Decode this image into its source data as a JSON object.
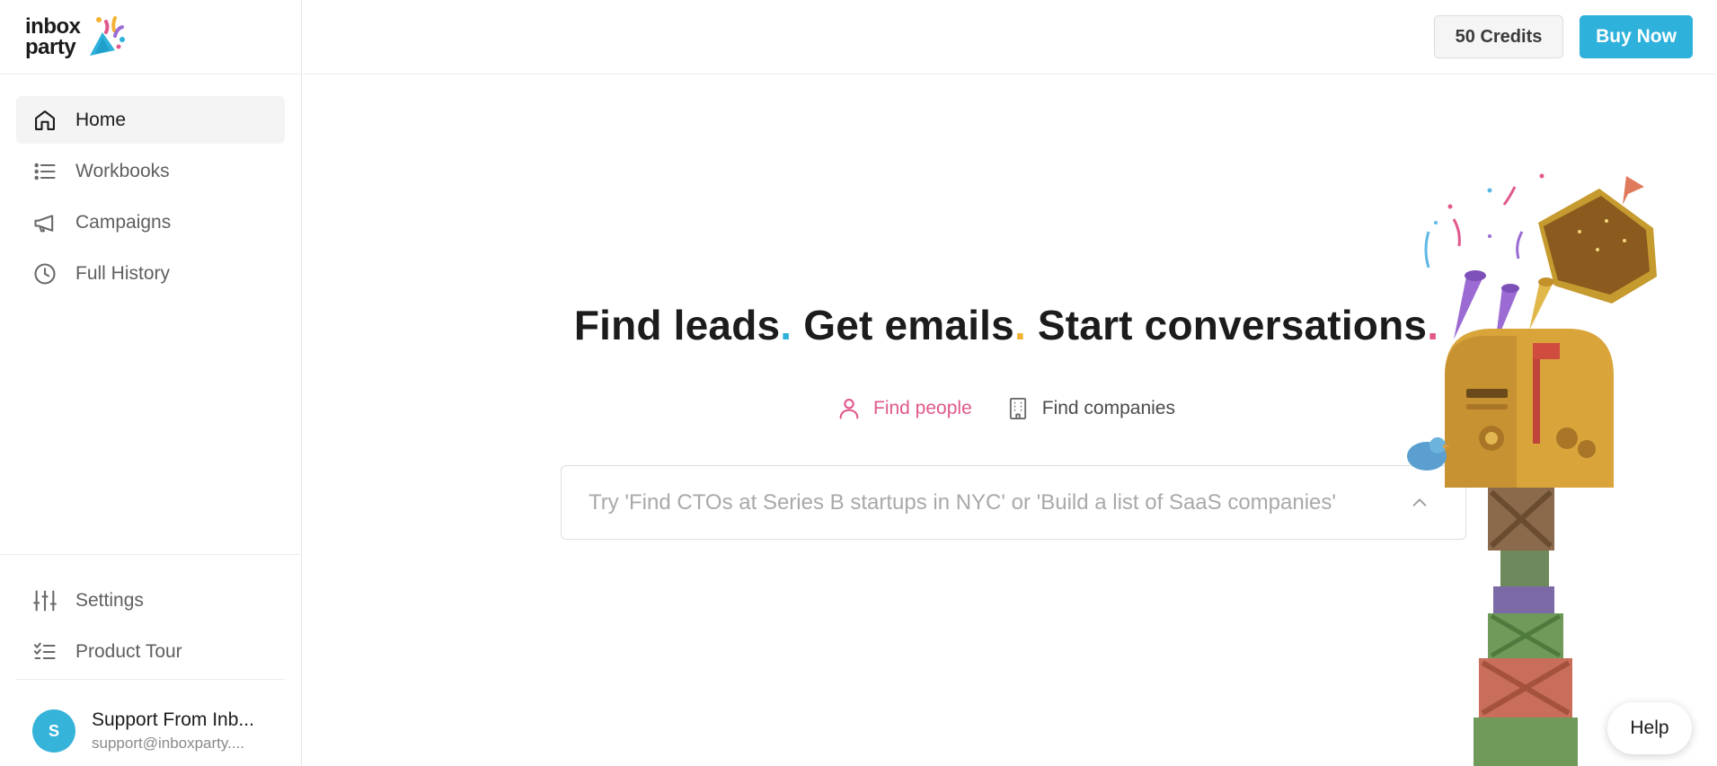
{
  "brand": {
    "line1": "inbox",
    "line2": "party"
  },
  "sidebar": {
    "items": [
      {
        "label": "Home",
        "icon": "home-icon",
        "active": true
      },
      {
        "label": "Workbooks",
        "icon": "list-icon",
        "active": false
      },
      {
        "label": "Campaigns",
        "icon": "megaphone-icon",
        "active": false
      },
      {
        "label": "Full History",
        "icon": "clock-icon",
        "active": false
      }
    ],
    "bottom_items": [
      {
        "label": "Settings",
        "icon": "sliders-icon"
      },
      {
        "label": "Product Tour",
        "icon": "checklist-icon"
      }
    ],
    "user": {
      "initial": "S",
      "name": "Support From Inb...",
      "email": "support@inboxparty...."
    }
  },
  "header": {
    "credits": "50 Credits",
    "buy": "Buy Now"
  },
  "hero": {
    "part1": "Find leads",
    "part2": " Get emails",
    "part3": " Start conversations",
    "dot": ".",
    "dot_colors": [
      "#2eb1db",
      "#f2b233",
      "#e0588c"
    ]
  },
  "modes": [
    {
      "label": "Find people",
      "icon": "person-icon",
      "active": true
    },
    {
      "label": "Find companies",
      "icon": "building-icon",
      "active": false
    }
  ],
  "search": {
    "placeholder": "Try 'Find CTOs at Series B startups in NYC' or 'Build a list of SaaS companies'",
    "value": ""
  },
  "help": {
    "label": "Help"
  },
  "colors": {
    "accent": "#2eb1db",
    "pink": "#e0588c",
    "gold": "#d9a43a"
  }
}
